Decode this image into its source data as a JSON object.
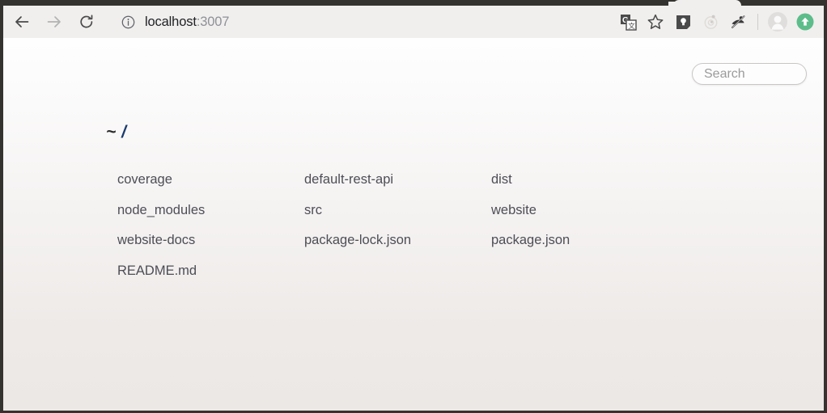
{
  "browser": {
    "tab": {
      "title": ""
    },
    "nav": {
      "back_label": "Back",
      "forward_label": "Forward",
      "reload_label": "Reload"
    },
    "omnibox": {
      "site_info_icon": "info-circle-icon",
      "url_host": "localhost",
      "url_rest": ":3007",
      "full_url": "localhost:3007"
    },
    "actions": [
      {
        "name": "google-translate-icon",
        "label": "Google Translate"
      },
      {
        "name": "bookmark-star-icon",
        "label": "Bookmark this tab"
      },
      {
        "name": "google-keep-icon",
        "label": "Google Keep"
      },
      {
        "name": "orbit-icon",
        "label": "Extension"
      },
      {
        "name": "ad-block-icon",
        "label": "Extension"
      },
      {
        "name": "profile-avatar-icon",
        "label": "Profile"
      },
      {
        "name": "update-arrow-icon",
        "label": "Update available"
      }
    ]
  },
  "page": {
    "search": {
      "placeholder": "Search",
      "value": ""
    },
    "breadcrumb": {
      "home": "~",
      "separator": "",
      "current": "/"
    },
    "files": [
      {
        "name": "coverage",
        "type": "directory"
      },
      {
        "name": "default-rest-api",
        "type": "directory"
      },
      {
        "name": "dist",
        "type": "directory"
      },
      {
        "name": "node_modules",
        "type": "directory"
      },
      {
        "name": "src",
        "type": "directory"
      },
      {
        "name": "website",
        "type": "directory"
      },
      {
        "name": "website-docs",
        "type": "directory"
      },
      {
        "name": "package-lock.json",
        "type": "file"
      },
      {
        "name": "package.json",
        "type": "file"
      },
      {
        "name": "README.md",
        "type": "file"
      }
    ]
  },
  "colors": {
    "chrome_bg": "#f1efee",
    "frame": "#35332f",
    "url_host": "#202124",
    "url_rest": "#8d9196",
    "link": "#4d4d55",
    "crumb_link": "#1a3b6e",
    "update_green": "#5dbd8a"
  }
}
